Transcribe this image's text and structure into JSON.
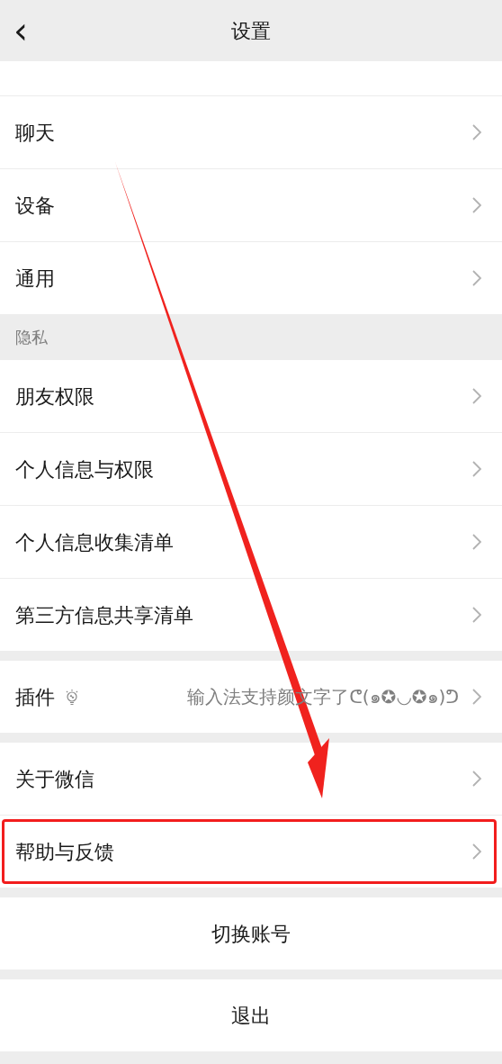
{
  "header": {
    "title": "设置",
    "back": "‹"
  },
  "sections": [
    {
      "items": [
        {
          "kind": "nav",
          "label": "聊天",
          "highlighted": false
        },
        {
          "kind": "nav",
          "label": "设备",
          "highlighted": false
        },
        {
          "kind": "nav",
          "label": "通用",
          "highlighted": false
        }
      ]
    },
    {
      "title": "隐私",
      "items": [
        {
          "kind": "nav",
          "label": "朋友权限",
          "highlighted": false
        },
        {
          "kind": "nav",
          "label": "个人信息与权限",
          "highlighted": false
        },
        {
          "kind": "nav",
          "label": "个人信息收集清单",
          "highlighted": false
        },
        {
          "kind": "nav",
          "label": "第三方信息共享清单",
          "highlighted": false
        }
      ]
    },
    {
      "items": [
        {
          "kind": "plugin",
          "label": "插件",
          "value": "输入法支持颜文字了ᕦ(๑✪◡✪๑)ᕤ",
          "highlighted": false
        }
      ]
    },
    {
      "items": [
        {
          "kind": "nav",
          "label": "关于微信",
          "highlighted": false
        },
        {
          "kind": "nav",
          "label": "帮助与反馈",
          "highlighted": true
        }
      ]
    },
    {
      "items": [
        {
          "kind": "action",
          "label": "切换账号",
          "highlighted": false
        }
      ]
    },
    {
      "items": [
        {
          "kind": "action",
          "label": "退出",
          "highlighted": false
        }
      ]
    }
  ]
}
